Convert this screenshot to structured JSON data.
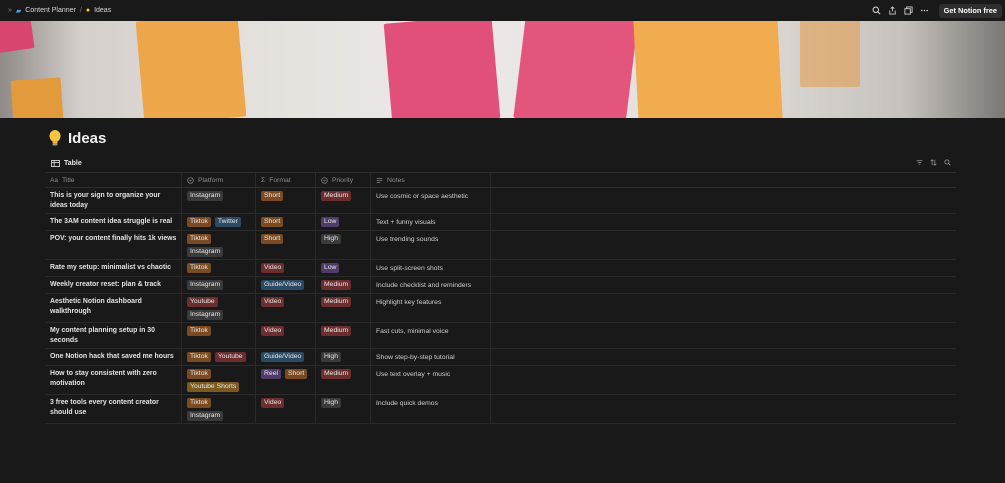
{
  "breadcrumb": {
    "parent_label": "Content Planner",
    "current_label": "Ideas",
    "separator": "/"
  },
  "topbar": {
    "cta_label": "Get Notion free"
  },
  "page": {
    "title": "Ideas",
    "icon": "lightbulb-icon"
  },
  "view": {
    "tab_label": "Table",
    "actions": [
      "filter-icon",
      "sort-icon",
      "search-icon"
    ]
  },
  "columns": {
    "title": "Title",
    "platform": "Platform",
    "format": "Format",
    "priority": "Priority",
    "notes": "Notes"
  },
  "tag_colors": {
    "Instagram": "#3a3a3a",
    "Tiktok": "#7a4b22",
    "Twitter": "#2c4a63",
    "Youtube": "#6b2d2d",
    "Youtube Shorts": "#7a5a1f",
    "Short": "#7a4b22",
    "Video": "#6b2d2d",
    "Guide/Video": "#2c4a63",
    "Reel": "#4f3c6b",
    "Medium": "#6b2d2d",
    "Low": "#4f3c6b",
    "High": "#3a3a3a"
  },
  "rows": [
    {
      "title": "This is your sign to organize your ideas today",
      "platform": [
        "Instagram"
      ],
      "format": [
        "Short"
      ],
      "priority": "Medium",
      "notes": "Use cosmic or space aesthetic"
    },
    {
      "title": "The 3AM content idea struggle is real",
      "platform": [
        "Tiktok",
        "Twitter"
      ],
      "format": [
        "Short"
      ],
      "priority": "Low",
      "notes": "Text + funny visuals"
    },
    {
      "title": "POV: your content finally hits 1k views",
      "platform": [
        "Tiktok",
        "Instagram"
      ],
      "format": [
        "Short"
      ],
      "priority": "High",
      "notes": "Use trending sounds"
    },
    {
      "title": "Rate my setup: minimalist vs chaotic",
      "platform": [
        "Tiktok"
      ],
      "format": [
        "Video"
      ],
      "priority": "Low",
      "notes": "Use split-screen shots"
    },
    {
      "title": "Weekly creator reset: plan & track",
      "platform": [
        "Instagram"
      ],
      "format": [
        "Guide/Video"
      ],
      "priority": "Medium",
      "notes": "Include checklist and reminders"
    },
    {
      "title": "Aesthetic Notion dashboard walkthrough",
      "platform": [
        "Youtube",
        "Instagram"
      ],
      "format": [
        "Video"
      ],
      "priority": "Medium",
      "notes": "Highlight key features"
    },
    {
      "title": "My content planning setup in 30 seconds",
      "platform": [
        "Tiktok"
      ],
      "format": [
        "Video"
      ],
      "priority": "Medium",
      "notes": "Fast cuts, minimal voice"
    },
    {
      "title": "One Notion hack that saved me hours",
      "platform": [
        "Tiktok",
        "Youtube"
      ],
      "format": [
        "Guide/Video"
      ],
      "priority": "High",
      "notes": "Show step-by-step tutorial"
    },
    {
      "title": "How to stay consistent with zero motivation",
      "platform": [
        "Tiktok",
        "Youtube Shorts"
      ],
      "format": [
        "Reel",
        "Short"
      ],
      "priority": "Medium",
      "notes": "Use text overlay + music"
    },
    {
      "title": "3 free tools every content creator should use",
      "platform": [
        "Tiktok",
        "Instagram"
      ],
      "format": [
        "Video"
      ],
      "priority": "High",
      "notes": "Include quick demos"
    }
  ]
}
